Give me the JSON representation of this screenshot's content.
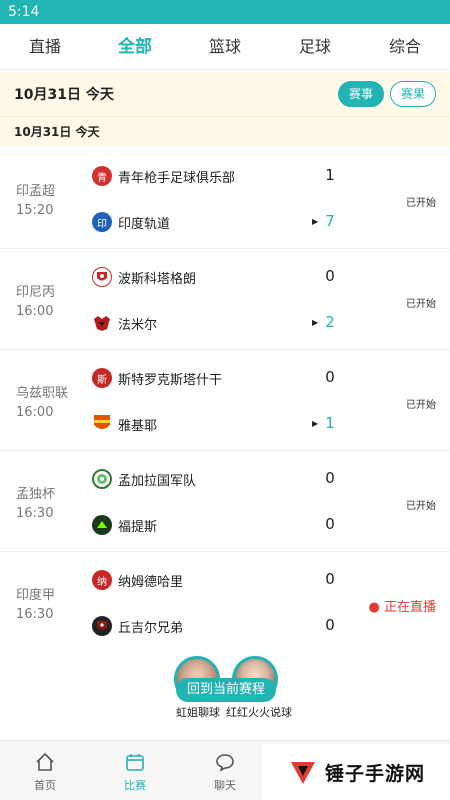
{
  "status_bar": {
    "time": "5:14"
  },
  "tabs": [
    "直播",
    "全部",
    "篮球",
    "足球",
    "综合"
  ],
  "date_header": {
    "label": "10月31日  今天",
    "event_btn": "赛事",
    "result_btn": "赛果"
  },
  "date_sub": "10月31日    今天",
  "matches": [
    {
      "league": "印孟超",
      "time": "15:20",
      "home": {
        "name": "青年枪手足球俱乐部",
        "badge": "青",
        "color": "#d32f2f"
      },
      "away": {
        "name": "印度轨道",
        "badge": "印",
        "color": "#1e63b5"
      },
      "home_score": "1",
      "away_score": "7",
      "status": "已开始"
    },
    {
      "league": "印尼丙",
      "time": "16:00",
      "home": {
        "name": "波斯科塔格朗",
        "badge": "",
        "color": "#c62828"
      },
      "away": {
        "name": "法米尔",
        "badge": "",
        "color": "#b71c1c"
      },
      "home_score": "0",
      "away_score": "2",
      "status": "已开始"
    },
    {
      "league": "乌兹职联",
      "time": "16:00",
      "home": {
        "name": "斯特罗克斯塔什干",
        "badge": "斯",
        "color": "#c62828"
      },
      "away": {
        "name": "雅基耶",
        "badge": "",
        "color": "#e65100"
      },
      "home_score": "0",
      "away_score": "1",
      "status": "已开始"
    },
    {
      "league": "孟独杯",
      "time": "16:30",
      "home": {
        "name": "孟加拉国军队",
        "badge": "",
        "color": "#2e7d32"
      },
      "away": {
        "name": "福提斯",
        "badge": "",
        "color": "#1b5e20"
      },
      "home_score": "0",
      "away_score": "0",
      "status": "已开始"
    },
    {
      "league": "印度甲",
      "time": "16:30",
      "home": {
        "name": "纳姆德哈里",
        "badge": "纳",
        "color": "#c62828"
      },
      "away": {
        "name": "丘吉尔兄弟",
        "badge": "",
        "color": "#8e1b1b"
      },
      "home_score": "0",
      "away_score": "0",
      "status": "正在直播",
      "live": true
    }
  ],
  "anchors": [
    {
      "name": "虹姐聊球"
    },
    {
      "name": "红红火火说球"
    }
  ],
  "back_button": "回到当前赛程",
  "bottom_nav": [
    {
      "label": "首页",
      "icon": "home-icon"
    },
    {
      "label": "比赛",
      "icon": "calendar-icon",
      "active": true
    },
    {
      "label": "聊天",
      "icon": "chat-icon"
    }
  ],
  "watermark": "锤子手游网",
  "colors": {
    "accent": "#22b3b3",
    "live": "#e53935",
    "header_bg": "#fff9e8"
  }
}
